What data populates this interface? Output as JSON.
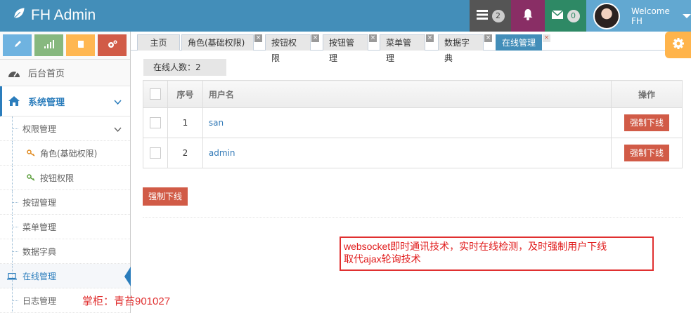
{
  "app": {
    "title": "FH Admin"
  },
  "navbar": {
    "tasks_badge": "2",
    "messages_badge": "0",
    "welcome": "Welcome",
    "username": "FH"
  },
  "sidebar": {
    "home": "后台首页",
    "system": "系统管理",
    "permission": "权限管理",
    "role": "角色(基础权限)",
    "button_perm": "按钮权限",
    "items": [
      "按钮管理",
      "菜单管理",
      "数据字典",
      "在线管理",
      "日志管理"
    ]
  },
  "tabs": [
    {
      "label": "主页"
    },
    {
      "label": "角色(基础权限)"
    },
    {
      "label": "按钮权限"
    },
    {
      "label": "按钮管理"
    },
    {
      "label": "菜单管理"
    },
    {
      "label": "数据字典"
    },
    {
      "label": "在线管理",
      "active": true
    }
  ],
  "content": {
    "online_count": "在线人数：2",
    "columns": [
      "序号",
      "用户名",
      "操作"
    ],
    "rows": [
      {
        "index": "1",
        "username": "san",
        "action": "强制下线"
      },
      {
        "index": "2",
        "username": "admin",
        "action": "强制下线"
      }
    ],
    "bulk_action": "强制下线"
  },
  "annotation": {
    "line1": "websocket即时通讯技术，实时在线检测，及时强制用户下线",
    "line2": "取代ajax轮询技术"
  },
  "credit": "掌柜：青苔901027",
  "colors": {
    "navbar": "#438eb9",
    "danger": "#d15b47",
    "accent": "#2b7dbc"
  }
}
